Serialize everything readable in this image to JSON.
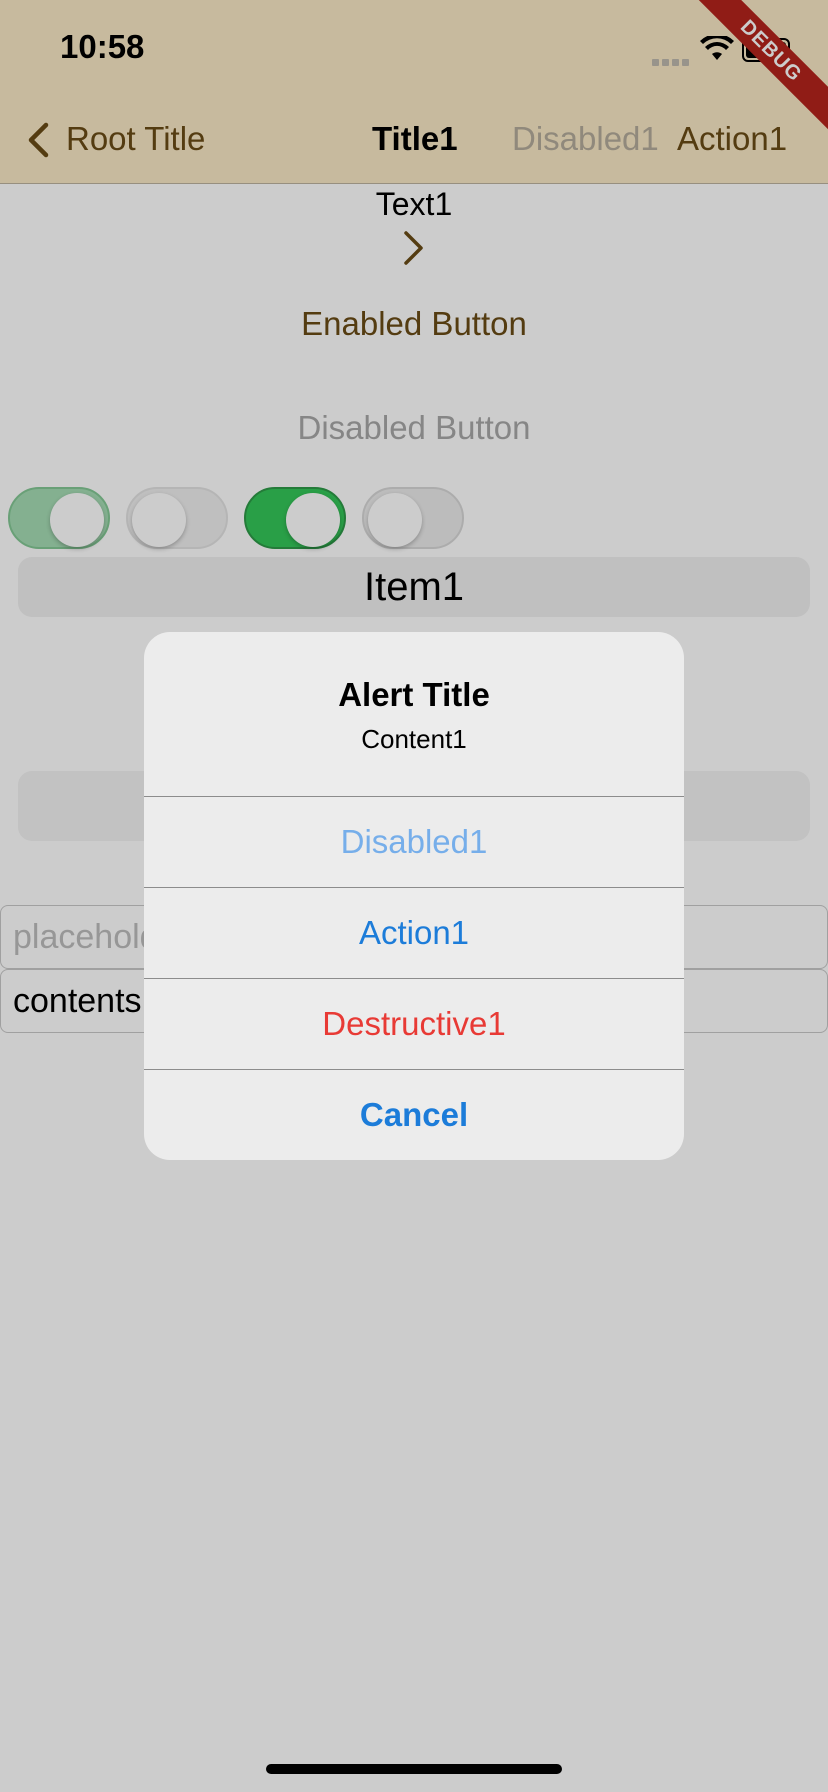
{
  "status_bar": {
    "time": "10:58",
    "debug_banner": "DEBUG"
  },
  "nav_bar": {
    "back_label": "Root Title",
    "title": "Title1",
    "disabled_action": "Disabled1",
    "action": "Action1"
  },
  "content": {
    "text1": "Text1",
    "enabled_button": "Enabled Button",
    "disabled_button": "Disabled Button",
    "switches": [
      {
        "state": "on",
        "enabled": false
      },
      {
        "state": "off",
        "enabled": false
      },
      {
        "state": "on",
        "enabled": true
      },
      {
        "state": "off",
        "enabled": true
      }
    ],
    "segment_item": "Item1",
    "field_placeholder": "placeholder",
    "field_contents": "contents"
  },
  "alert": {
    "title": "Alert Title",
    "content": "Content1",
    "buttons": [
      {
        "label": "Disabled1",
        "style": "disabled"
      },
      {
        "label": "Action1",
        "style": "default"
      },
      {
        "label": "Destructive1",
        "style": "destructive"
      },
      {
        "label": "Cancel",
        "style": "cancel"
      }
    ]
  },
  "colors": {
    "nav_background": "#f9e9c6",
    "accent_brown": "#6a4b16",
    "ios_blue": "#1c7cd9",
    "destructive_red": "#e83a35",
    "switch_green": "#34c759"
  }
}
